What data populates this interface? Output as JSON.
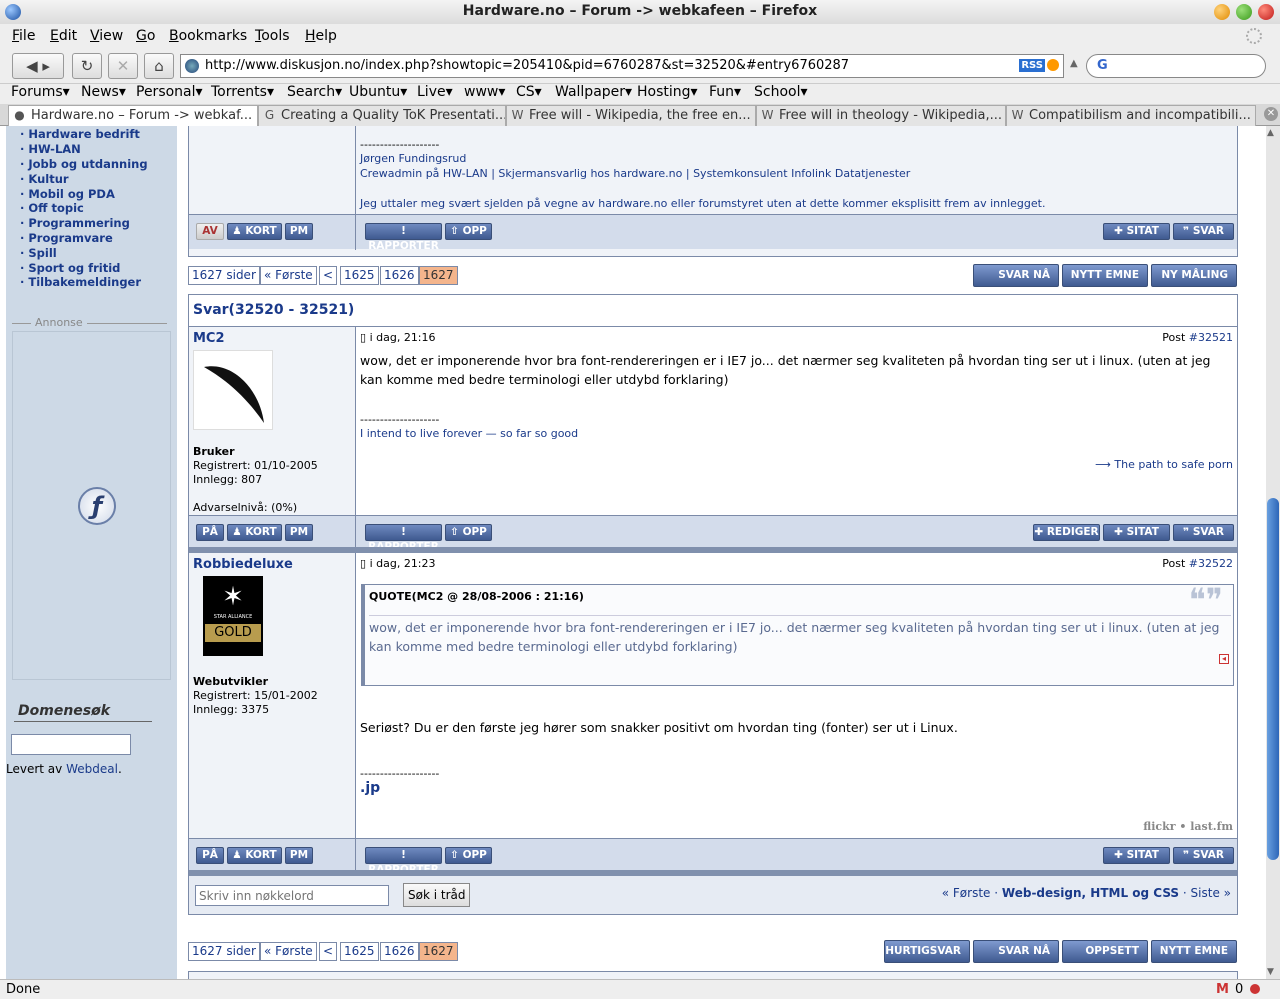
{
  "window": {
    "title": "Hardware.no – Forum -> webkafeen – Firefox"
  },
  "menu": [
    "File",
    "Edit",
    "View",
    "Go",
    "Bookmarks",
    "Tools",
    "Help"
  ],
  "nav": {
    "url": "http://www.diskusjon.no/index.php?showtopic=205410&pid=6760287&st=32520&#entry6760287",
    "rss": "RSS",
    "search_logo": "G"
  },
  "bookmarks": [
    "Forums▾",
    "News▾",
    "Personal▾",
    "Torrents▾",
    "Search▾",
    "Ubuntu▾",
    "Live▾",
    "www▾",
    "CS▾",
    "Wallpaper▾",
    "Hosting▾",
    "Fun▾",
    "School▾"
  ],
  "tabs": [
    {
      "label": "Hardware.no – Forum -> webkaf...",
      "icon": "globe-icon"
    },
    {
      "label": "Creating a Quality ToK Presentati...",
      "icon": "google-icon"
    },
    {
      "label": "Free will - Wikipedia, the free en...",
      "icon": "wikipedia-icon"
    },
    {
      "label": "Free will in theology - Wikipedia,...",
      "icon": "wikipedia-icon"
    },
    {
      "label": "Compatibilism and incompatibili...",
      "icon": "wikipedia-icon"
    }
  ],
  "sidebar": {
    "items": [
      "Hardware bedrift",
      "HW-LAN",
      "Jobb og utdanning",
      "Kultur",
      "Mobil og PDA",
      "Off topic",
      "Programmering",
      "Programvare",
      "Spill",
      "Sport og fritid",
      "Tilbakemeldinger"
    ],
    "ad_label": "Annonse",
    "domain_search": "Domenesøk",
    "provided_by": "Levert av",
    "webdeal": "Webdeal"
  },
  "prev_post": {
    "sig_line": "--------------------",
    "name": "Jørgen Fundingsrud",
    "roles": "Crewadmin på HW-LAN | Skjermansvarlig hos hardware.no | Systemkonsulent Infolink Datatjenester",
    "disclaimer": "Jeg uttaler meg svært sjelden på vegne av hardware.no eller forumstyret uten at dette kommer eksplisitt frem av innlegget."
  },
  "buttons": {
    "av": "AV",
    "pa": "PÅ",
    "kort": "KORT",
    "pm": "PM",
    "rapporter": "RAPPORTER",
    "opp": "OPP",
    "sitat": "SITAT",
    "svar": "SVAR",
    "rediger": "REDIGER"
  },
  "pager": {
    "pages": "1627 sider",
    "first": "« Første",
    "prev": "<",
    "p1": "1625",
    "p2": "1626",
    "cur": "1627"
  },
  "top_buttons": {
    "svar_na": "SVAR NÅ",
    "nytt_emne": "NYTT EMNE",
    "ny_maling": "NY MÅLING"
  },
  "bottom_buttons": {
    "hurtigsvar": "HURTIGSVAR",
    "svar_na": "SVAR NÅ",
    "oppsett": "OPPSETT",
    "nytt_emne": "NYTT EMNE"
  },
  "section_title": "Svar(32520 - 32521)",
  "post1": {
    "author": "MC2",
    "date": "i dag, 21:16",
    "post_label": "Post",
    "post_num": "#32521",
    "rank": "Bruker",
    "registered": "Registrert: 01/10-2005",
    "posts": "Innlegg: 807",
    "warning": "Advarselnivå: (0%)",
    "body": "wow, det er imponerende hvor bra font-rendereringen er i IE7 jo... det nærmer seg kvaliteten på hvordan ting ser ut i linux. (uten at jeg kan komme med bedre terminologi eller utdybd forklaring)",
    "sig_line": "--------------------",
    "sig": "I intend to live forever — so far so good",
    "link": "The path to safe porn"
  },
  "post2": {
    "author": "Robbiedeluxe",
    "date": "i dag, 21:23",
    "post_label": "Post",
    "post_num": "#32522",
    "avatar_text": "STAR ALLIANCE",
    "avatar_gold": "GOLD",
    "rank": "Webutvikler",
    "registered": "Registrert: 15/01-2002",
    "posts": "Innlegg: 3375",
    "quote_header": "QUOTE(MC2 @ 28/08-2006 : 21:16)",
    "quote": "wow, det er imponerende hvor bra font-rendereringen er i IE7 jo... det nærmer seg kvaliteten på hvordan ting ser ut i linux. (uten at jeg kan komme med bedre terminologi eller utdybd forklaring)",
    "body": "Seriøst? Du er den første jeg hører som snakker positivt om hvordan ting (fonter) ser ut i Linux.",
    "sig_line": "--------------------",
    "sig": ".jp",
    "flickr": "flickr • last.fm"
  },
  "search": {
    "placeholder": "Skriv inn nøkkelord",
    "button": "Søk i tråd"
  },
  "forum_nav": {
    "first": "« Første",
    "sep1": "·",
    "forum": "Web-design, HTML og CSS",
    "sep2": "·",
    "last": "Siste »"
  },
  "status": {
    "text": "Done",
    "mail_count": "0"
  }
}
